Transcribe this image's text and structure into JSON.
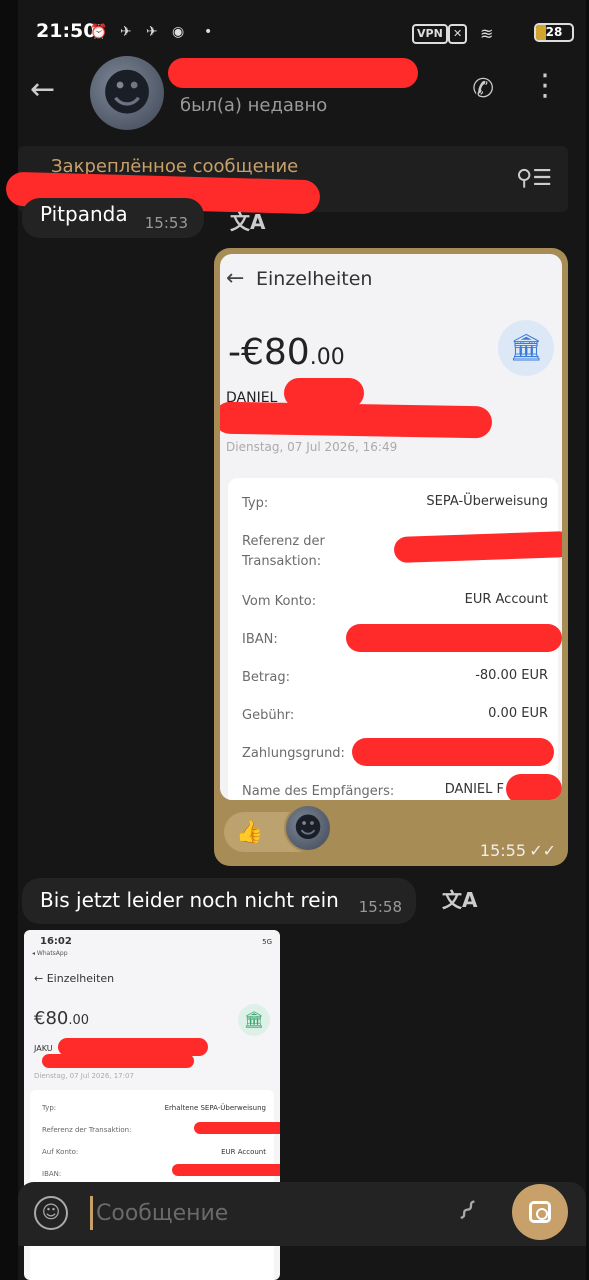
{
  "status_bar": {
    "time": "21:50",
    "icons": [
      "alarm-off-icon",
      "notification-icon",
      "notification-icon",
      "app-icon",
      "dot-icon"
    ],
    "vpn_label": "VPN",
    "battery_level": "28"
  },
  "header": {
    "last_seen": "был(а) недавно",
    "avatar_icon": "moon-face-icon"
  },
  "pinned": {
    "label": "Закреплённое сообщение"
  },
  "messages": {
    "m1": {
      "text": "Pitpanda",
      "time": "15:53"
    },
    "m2": {
      "text": "Bis jetzt leider noch nicht rein",
      "time": "15:58"
    }
  },
  "outgoing": {
    "time": "15:55",
    "reaction": "👍",
    "screenshot": {
      "title": "Einzelheiten",
      "amount_main": "-€80",
      "amount_cents": ".00",
      "name": "DANIEL",
      "date": "Dienstag, 07 Jul 2026, 16:49",
      "rows": [
        {
          "k": "Typ:",
          "v": "SEPA-Überweisung"
        },
        {
          "k": "Referenz der Transaktion:",
          "v": ""
        },
        {
          "k": "Vom Konto:",
          "v": "EUR Account"
        },
        {
          "k": "IBAN:",
          "v": ""
        },
        {
          "k": "Betrag:",
          "v": "-80.00 EUR"
        },
        {
          "k": "Gebühr:",
          "v": "0.00 EUR"
        },
        {
          "k": "Zahlungsgrund:",
          "v": ""
        },
        {
          "k": "Name des Empfängers:",
          "v": "DANIEL F"
        }
      ]
    }
  },
  "incoming_screenshot": {
    "status_time": "16:02",
    "app_back": "◂ WhatsApp",
    "signal": "5G",
    "title": "Einzelheiten",
    "amount_main": "€80",
    "amount_cents": ".00",
    "name": "JAKU",
    "date": "Dienstag, 07 Jul 2026, 17:07",
    "rows": [
      {
        "k": "Typ:",
        "v": "Erhaltene SEPA-Überweisung"
      },
      {
        "k": "Referenz der Transaktion:",
        "v": ""
      },
      {
        "k": "Auf Konto:",
        "v": "EUR Account"
      },
      {
        "k": "IBAN:",
        "v": ""
      }
    ]
  },
  "composer": {
    "placeholder": "Сообщение"
  },
  "colors": {
    "accent": "#c8a06a",
    "outgoing_bubble": "#a88c56",
    "incoming_bubble": "#232323",
    "redaction": "#ff2b2b"
  }
}
